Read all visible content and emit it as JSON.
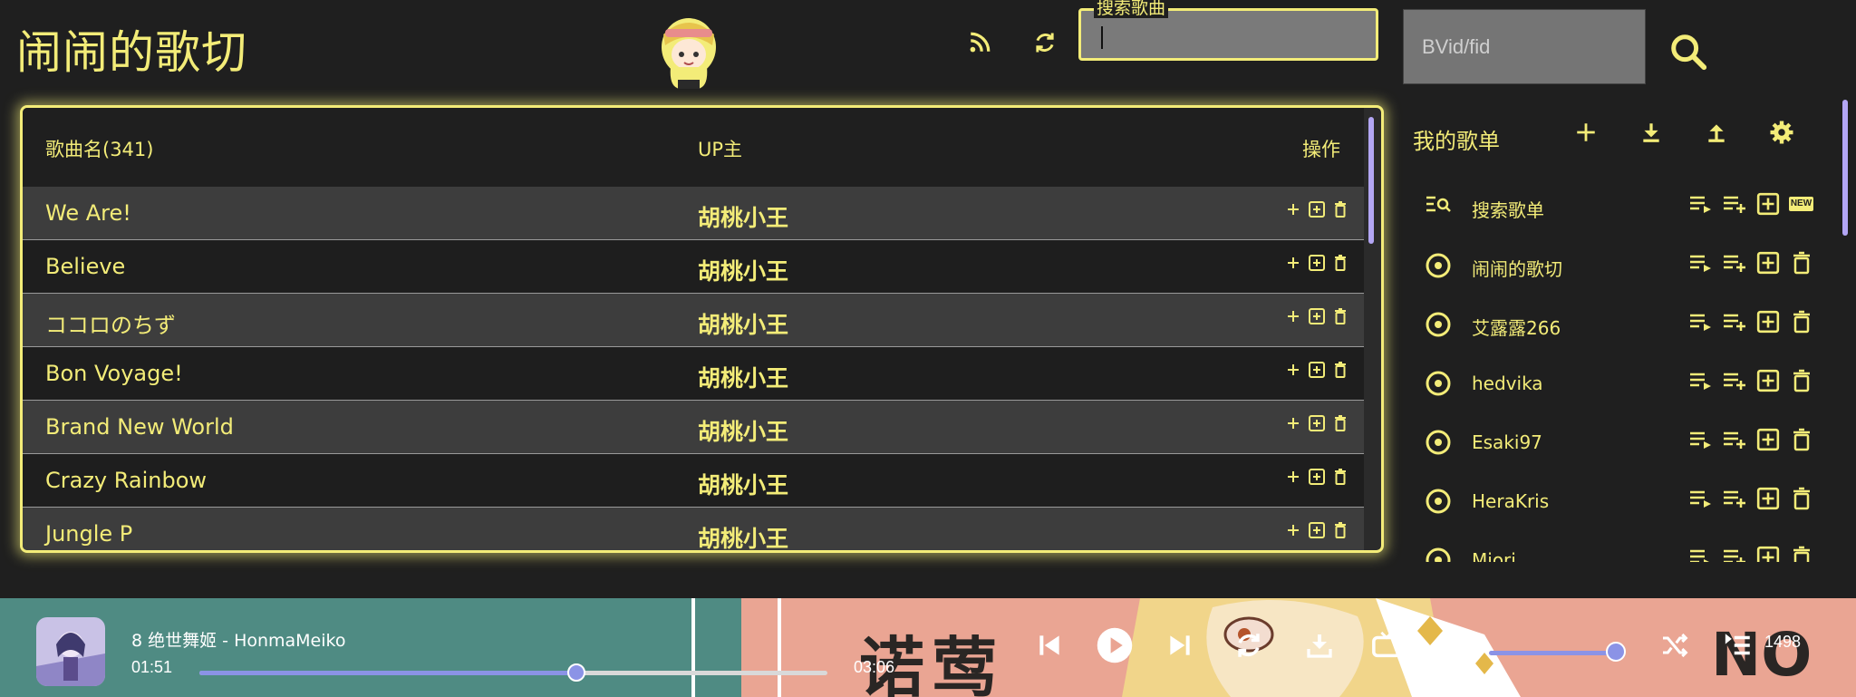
{
  "app": {
    "title": "闹闹的歌切"
  },
  "header": {
    "search_legend": "搜索歌曲",
    "search_value": "",
    "bvid_placeholder": "BVid/fid"
  },
  "songs": {
    "columns": {
      "name": "歌曲名(341)",
      "uploader": "UP主",
      "actions": "操作"
    },
    "rows": [
      {
        "name": "We Are!",
        "uploader": "胡桃小王"
      },
      {
        "name": "Believe",
        "uploader": "胡桃小王"
      },
      {
        "name": "ココロのちず",
        "uploader": "胡桃小王"
      },
      {
        "name": "Bon Voyage!",
        "uploader": "胡桃小王"
      },
      {
        "name": "Brand New World",
        "uploader": "胡桃小王"
      },
      {
        "name": "Crazy Rainbow",
        "uploader": "胡桃小王"
      },
      {
        "name": "Jungle P",
        "uploader": "胡桃小王"
      }
    ]
  },
  "playlists": {
    "title": "我的歌单",
    "items": [
      {
        "name": "搜索歌单",
        "icon": "search-list-icon",
        "badge": "NEW"
      },
      {
        "name": "闹闹的歌切",
        "icon": "disc-icon"
      },
      {
        "name": "艾露露266",
        "icon": "disc-icon"
      },
      {
        "name": "hedvika",
        "icon": "disc-icon"
      },
      {
        "name": "Esaki97",
        "icon": "disc-icon"
      },
      {
        "name": "HeraKris",
        "icon": "disc-icon"
      },
      {
        "name": "Miori",
        "icon": "disc-icon"
      }
    ]
  },
  "player": {
    "now_playing": "8 绝世舞姬 - HonmaMeiko",
    "current_time": "01:51",
    "total_time": "03:06",
    "progress": 0.6,
    "volume": 0.93,
    "playlist_count": "1498",
    "background_text": [
      "诺",
      "莺",
      "NO"
    ]
  },
  "colors": {
    "accent": "#f3ec78",
    "background": "#1f1f1f",
    "row_alt": "#3d3d3d",
    "scroll": "#b3a6f4",
    "player_left": "#4f8b83",
    "player_right": "#eaa593",
    "progress": "#8b93e6"
  }
}
